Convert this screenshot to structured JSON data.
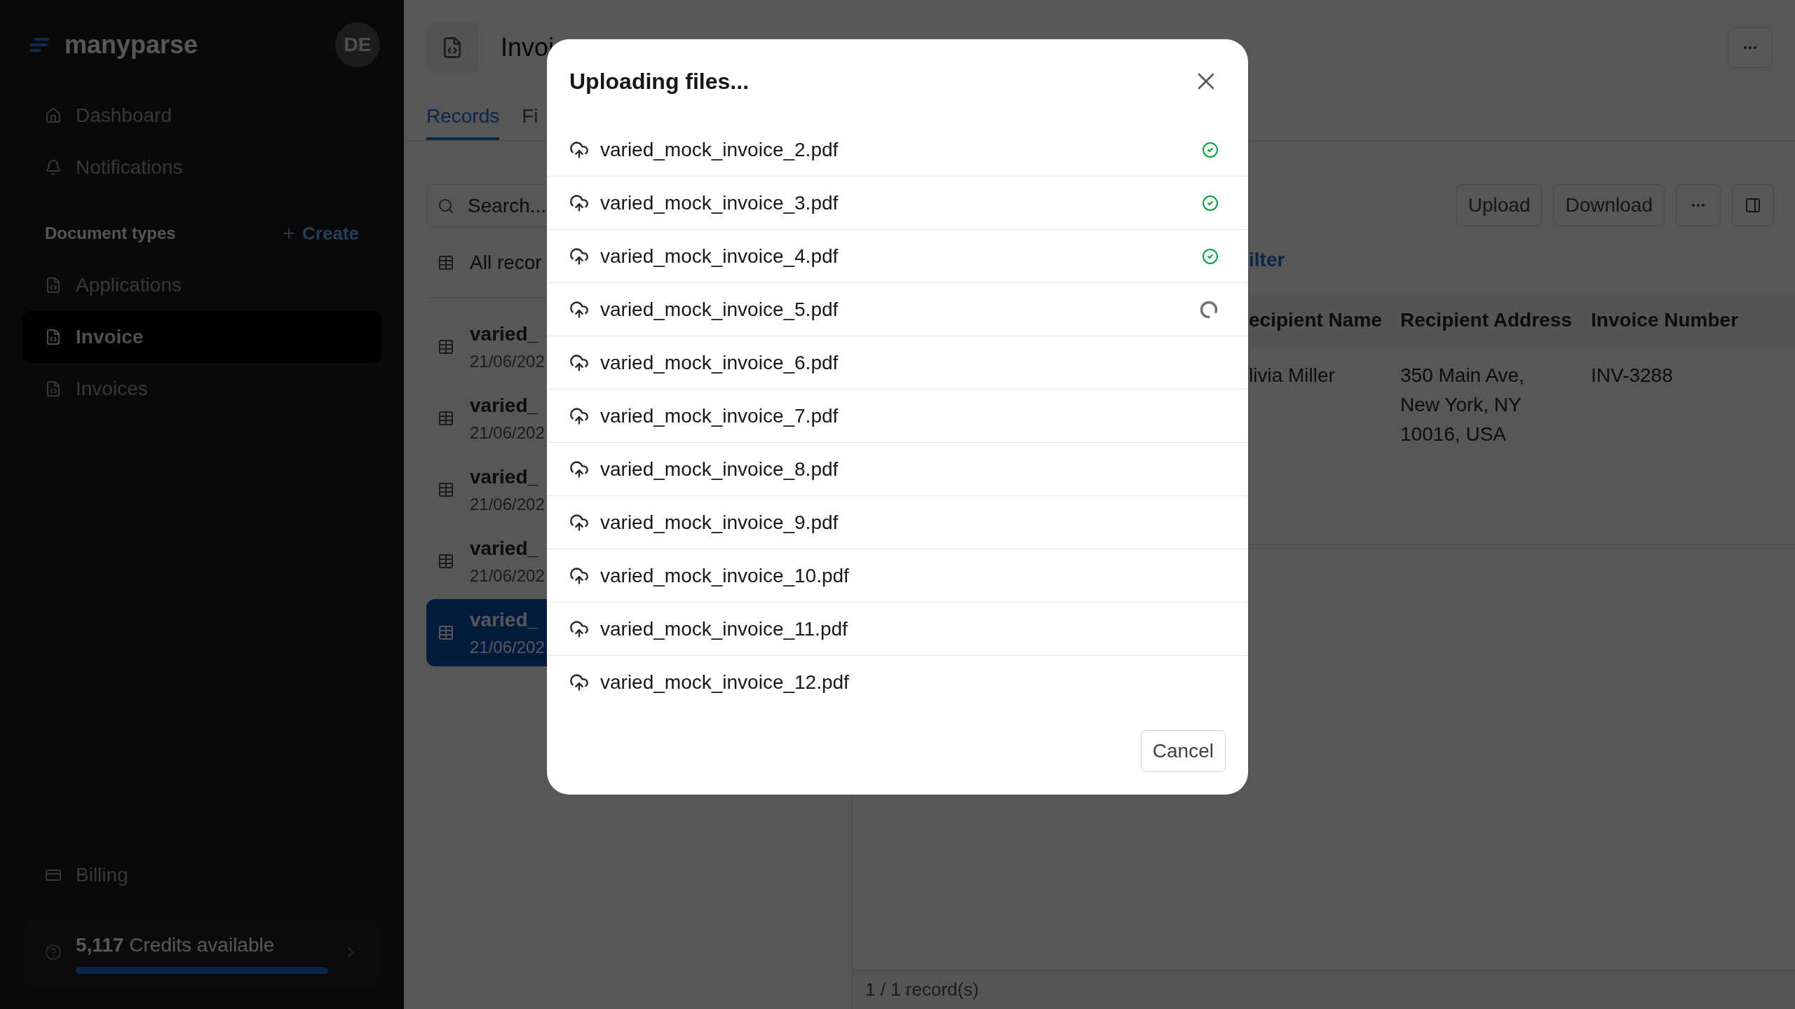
{
  "sidebar": {
    "logo": "manyparse",
    "avatar": "DE",
    "nav": [
      {
        "label": "Dashboard"
      },
      {
        "label": "Notifications"
      }
    ],
    "section": {
      "title": "Document types",
      "action": "Create"
    },
    "doc_types": [
      {
        "label": "Applications",
        "selected": false
      },
      {
        "label": "Invoice",
        "selected": true
      },
      {
        "label": "Invoices",
        "selected": false
      }
    ],
    "billing": "Billing",
    "credits": {
      "text": "**5,117** Credits available",
      "level": 1
    }
  },
  "main": {
    "title": "Invoi",
    "tabs": [
      {
        "label": "Records",
        "selected": true
      },
      {
        "label": "Fi",
        "selected": false
      }
    ],
    "search": {
      "placeholder": "Search..."
    },
    "all_records": "All recor",
    "records": [
      {
        "name": "varied_",
        "date": "21/06/202",
        "selected": false
      },
      {
        "name": "varied_",
        "date": "21/06/202",
        "selected": false
      },
      {
        "name": "varied_",
        "date": "21/06/202",
        "selected": false
      },
      {
        "name": "varied_",
        "date": "21/06/202",
        "selected": false
      },
      {
        "name": "varied_",
        "date": "21/06/202",
        "selected": true
      }
    ],
    "toolbar": [
      "Upload",
      "Download"
    ],
    "filter": "ilter",
    "table": {
      "columns": [
        "ecipient Name",
        "Recipient Address",
        "Invoice Number"
      ],
      "rows": [
        [
          "livia Miller",
          "350 Main Ave, New York, NY 10016, USA",
          "INV-3288"
        ]
      ]
    },
    "footer": "1 / 1 record(s)"
  },
  "dialog": {
    "title": "Uploading files...",
    "files": [
      {
        "name": "varied_mock_invoice_2.pdf",
        "complete": true,
        "in_progress": false
      },
      {
        "name": "varied_mock_invoice_3.pdf",
        "complete": true,
        "in_progress": false
      },
      {
        "name": "varied_mock_invoice_4.pdf",
        "complete": true,
        "in_progress": false
      },
      {
        "name": "varied_mock_invoice_5.pdf",
        "complete": false,
        "in_progress": true
      },
      {
        "name": "varied_mock_invoice_6.pdf",
        "complete": false,
        "in_progress": false
      },
      {
        "name": "varied_mock_invoice_7.pdf",
        "complete": false,
        "in_progress": false
      },
      {
        "name": "varied_mock_invoice_8.pdf",
        "complete": false,
        "in_progress": false
      },
      {
        "name": "varied_mock_invoice_9.pdf",
        "complete": false,
        "in_progress": false
      },
      {
        "name": "varied_mock_invoice_10.pdf",
        "complete": false,
        "in_progress": false
      },
      {
        "name": "varied_mock_invoice_11.pdf",
        "complete": false,
        "in_progress": false
      },
      {
        "name": "varied_mock_invoice_12.pdf",
        "complete": false,
        "in_progress": false
      }
    ],
    "cancel": "Cancel"
  }
}
